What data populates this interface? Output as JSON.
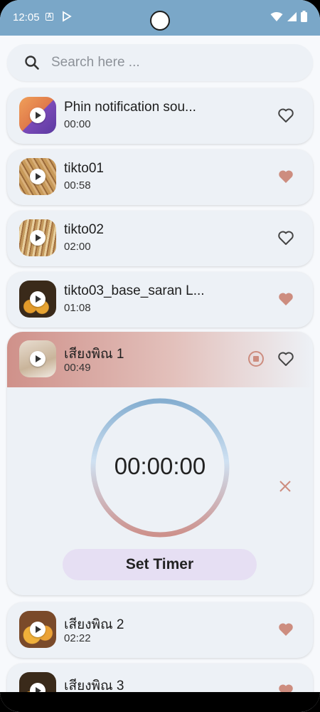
{
  "status_bar": {
    "time": "12:05",
    "a_icon_letter": "A"
  },
  "search": {
    "placeholder": "Search here ..."
  },
  "sounds": [
    {
      "title": "Phin notification sou...",
      "duration": "00:00",
      "favorite": false
    },
    {
      "title": "tikto01",
      "duration": "00:58",
      "favorite": true
    },
    {
      "title": "tikto02",
      "duration": "02:00",
      "favorite": false
    },
    {
      "title": "tikto03_base_saran L...",
      "duration": "01:08",
      "favorite": true
    },
    {
      "title": "เสียงพิณ 1",
      "duration": "00:49",
      "favorite": false,
      "playing": true
    },
    {
      "title": "เสียงพิณ 2",
      "duration": "02:22",
      "favorite": true
    },
    {
      "title": "เสียงพิณ 3",
      "duration": "",
      "favorite": true
    }
  ],
  "timer": {
    "display": "00:00:00",
    "set_label": "Set Timer"
  },
  "colors": {
    "accent": "#cd8d7f",
    "status_bar": "#7aa7c8",
    "card": "#edf1f6",
    "button": "#e6dff3"
  }
}
